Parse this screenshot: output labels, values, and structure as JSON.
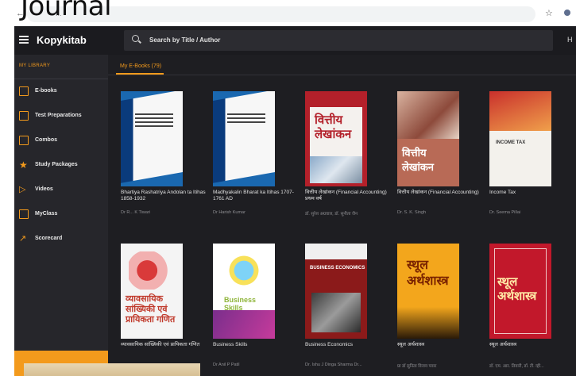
{
  "overlay_title": "Journal",
  "browser": {
    "url_text": "...",
    "star_icon": "star-icon",
    "profile_icon": "profile-icon"
  },
  "header": {
    "brand": "Kopykitab",
    "search_placeholder": "Search by Title / Author",
    "user_initial": "H"
  },
  "sidebar": {
    "heading": "MY LIBRARY",
    "items": [
      {
        "label": "E-books",
        "icon": "ebook-icon"
      },
      {
        "label": "Test Preparations",
        "icon": "test-icon"
      },
      {
        "label": "Combos",
        "icon": "combo-icon"
      },
      {
        "label": "Study Packages",
        "icon": "star-badge-icon"
      },
      {
        "label": "Videos",
        "icon": "play-icon"
      },
      {
        "label": "MyClass",
        "icon": "class-icon"
      },
      {
        "label": "Scorecard",
        "icon": "chart-icon"
      }
    ]
  },
  "main": {
    "tab_label": "My E-Books (79)",
    "books": [
      {
        "title": "Bhartiya Rashatriya Andolan ta Itihas 1858-1932",
        "author": "Dr R... K Tiwari"
      },
      {
        "title": "Madhyakalin Bharat ka Itihas 1707-1761 AD",
        "author": "Dr Harish Kumar"
      },
      {
        "title": "वित्तीय लेखांकन (Financial Accounting) प्रथम वर्ष",
        "author": "डॉ. सुरेश अग्रवाल, डॉ. सुनीता जैन"
      },
      {
        "title": "वित्तीय लेखांकन (Financial Accounting)",
        "author": "Dr. S. K. Singh"
      },
      {
        "title": "Income Tax",
        "author": "Dr. Seema Pillai"
      },
      {
        "title": "व्यावसायिक सांख्यिकी एवं प्रायिकता गणित",
        "author": ""
      },
      {
        "title": "Business Skills",
        "author": "Dr Anil P Patil"
      },
      {
        "title": "Business Economics",
        "author": "Dr. Ishu J Dinga Sharma Dr..."
      },
      {
        "title": "स्थूल अर्थशास्त्र",
        "author": "प्रा डॉ सुनिता विजय पवार"
      },
      {
        "title": "स्थूल अर्थशास्त्र",
        "author": "डॉ. एम. आर. तिवारी, डॉ. टी. व्ही..."
      }
    ],
    "cover_texts": {
      "c3": "वित्तीय लेखांकन",
      "c4": "वित्तीय लेखांकन",
      "c5": "INCOME TAX",
      "c6": "व्यावसायिक सांख्यिकी एवं प्रायिकता गणित",
      "c7": "Business Skills",
      "c8": "BUSINESS ECONOMICS",
      "c9": "स्थूल अर्थशास्त्र",
      "c10": "स्थूल अर्थशास्त्र"
    }
  },
  "colors": {
    "accent": "#f39a1c",
    "header_bg": "#1b1b1f",
    "sidebar_bg": "#26262b",
    "main_bg": "#1e1e22"
  }
}
